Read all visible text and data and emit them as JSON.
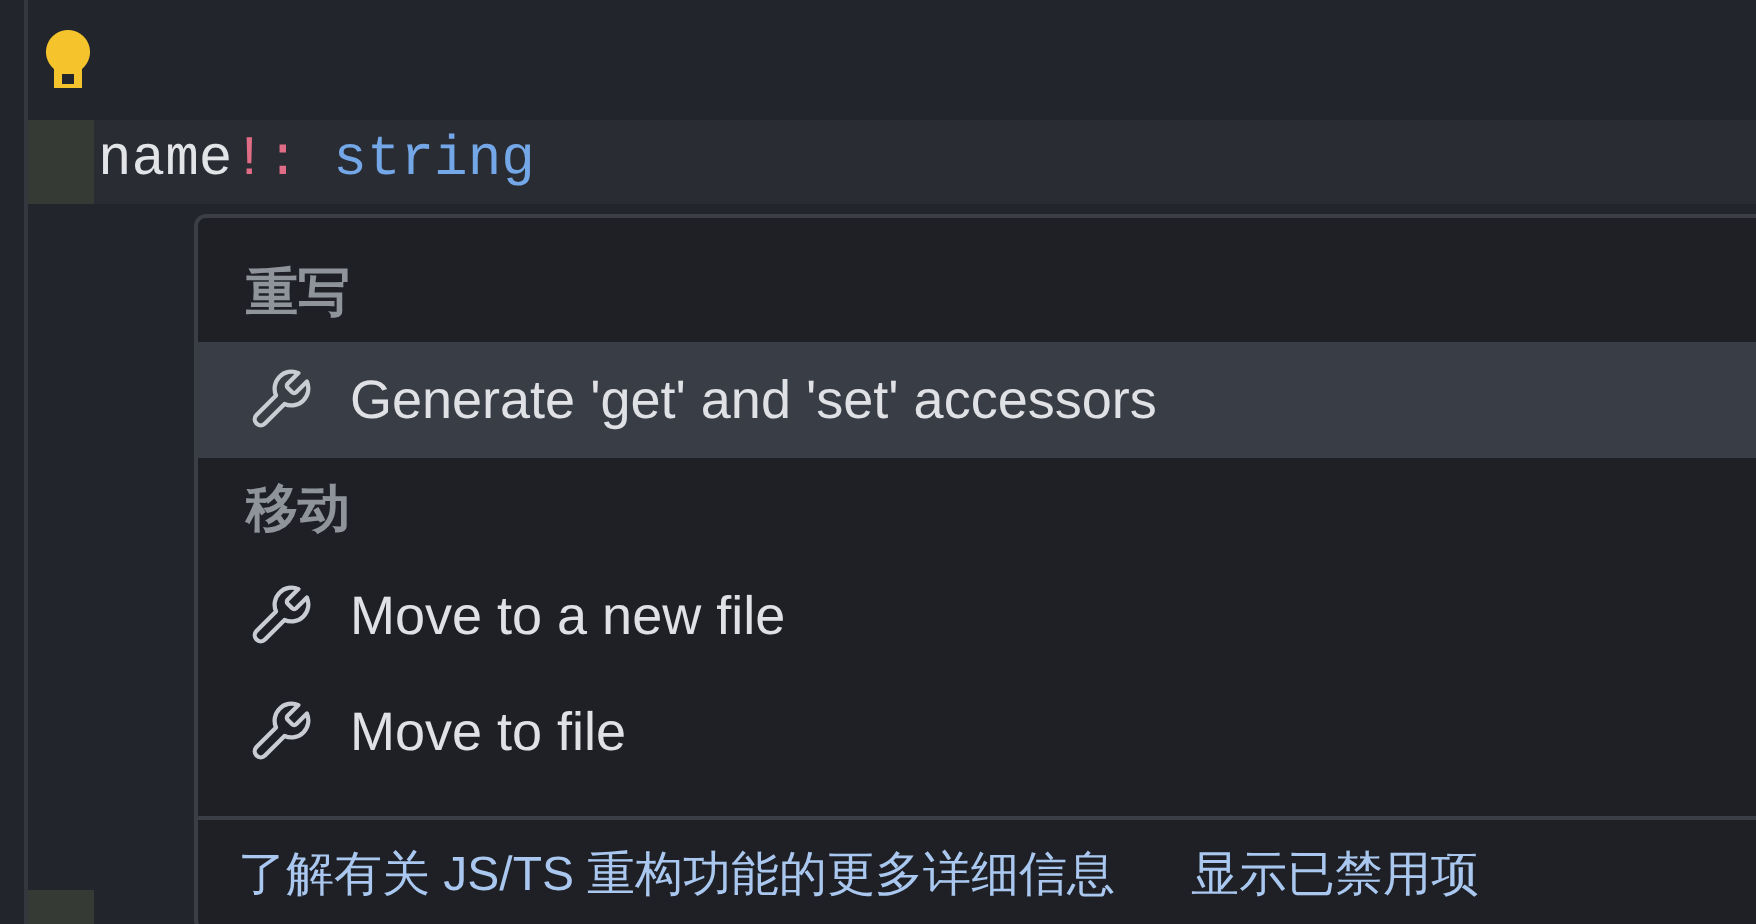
{
  "editor": {
    "code_line": [
      {
        "kind": "name",
        "text": "name"
      },
      {
        "kind": "operator",
        "text": "!: "
      },
      {
        "kind": "type",
        "text": "string"
      }
    ]
  },
  "menu": {
    "groups": [
      {
        "heading": "重写",
        "items": [
          {
            "label": "Generate 'get' and 'set' accessors",
            "selected": true
          }
        ]
      },
      {
        "heading": "移动",
        "items": [
          {
            "label": "Move to a new file",
            "selected": false
          },
          {
            "label": "Move to file",
            "selected": false
          }
        ]
      }
    ],
    "footer": [
      {
        "label": "了解有关 JS/TS 重构功能的更多详细信息"
      },
      {
        "label": "显示已禁用项"
      }
    ]
  }
}
